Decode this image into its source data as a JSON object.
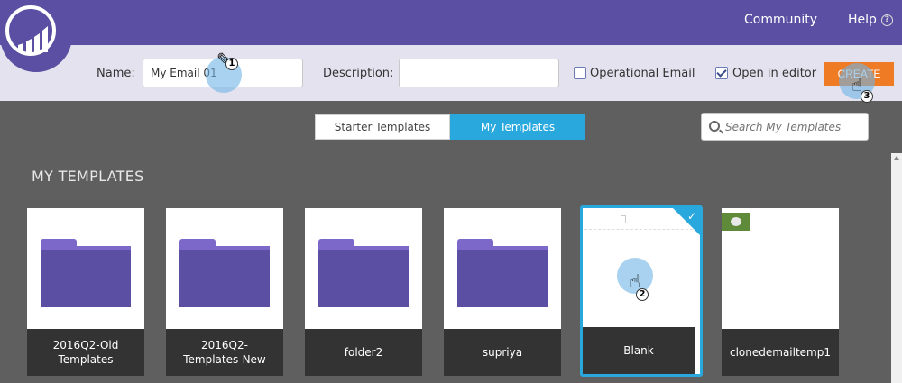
{
  "nav": {
    "community": "Community",
    "help": "Help",
    "help_icon": "?"
  },
  "form": {
    "name_label": "Name:",
    "name_value": "My Email 01",
    "description_label": "Description:",
    "description_value": "",
    "operational_label": "Operational Email",
    "operational_checked": false,
    "open_editor_label": "Open in editor",
    "open_editor_checked": true,
    "create_label": "CREATE"
  },
  "tabs": [
    {
      "label": "Starter Templates",
      "active": false
    },
    {
      "label": "My Templates",
      "active": true
    }
  ],
  "search": {
    "placeholder": "Search My Templates"
  },
  "section_title": "MY TEMPLATES",
  "templates": [
    {
      "name": "2016Q2-Old Templates",
      "kind": "folder"
    },
    {
      "name": "2016Q2-Templates-New",
      "kind": "folder"
    },
    {
      "name": "folder2",
      "kind": "folder"
    },
    {
      "name": "supriya",
      "kind": "folder"
    },
    {
      "name": "Blank",
      "kind": "template",
      "selected": true
    },
    {
      "name": "clonedemailtemp1",
      "kind": "template"
    }
  ],
  "steps": [
    "1",
    "2",
    "3"
  ],
  "colors": {
    "brand": "#5a4fa2",
    "accent": "#29a8de",
    "create": "#f07b25"
  }
}
